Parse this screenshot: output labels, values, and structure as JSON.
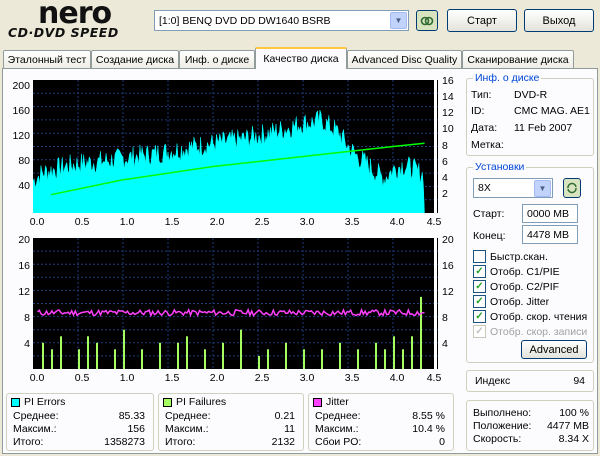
{
  "app": {
    "logo": "nero",
    "logo_sub": "CD·DVD SPEED"
  },
  "toolbar": {
    "drive": "[1:0]  BENQ DVD DD DW1640 BSRB",
    "start_label": "Старт",
    "exit_label": "Выход",
    "refresh_icon": "refresh-icon"
  },
  "tabs": [
    {
      "label": "Эталонный тест",
      "active": false
    },
    {
      "label": "Создание диска",
      "active": false
    },
    {
      "label": "Инф. о диске",
      "active": false
    },
    {
      "label": "Качество диска",
      "active": true
    },
    {
      "label": "Advanced Disc Quality",
      "active": false
    },
    {
      "label": "Сканирование диска",
      "active": false
    }
  ],
  "disc_info": {
    "title": "Инф. о диске",
    "type_label": "Тип:",
    "type_value": "DVD-R",
    "id_label": "ID:",
    "id_value": "CMC MAG. AE1",
    "date_label": "Дата:",
    "date_value": "11 Feb 2007",
    "label_label": "Метка:",
    "label_value": ""
  },
  "settings": {
    "title": "Установки",
    "speed": "8X",
    "start_label": "Старт:",
    "start_value": "0000 MB",
    "end_label": "Конец:",
    "end_value": "4478 MB",
    "checkboxes": [
      {
        "label": "Быстр.скан.",
        "checked": false,
        "enabled": true
      },
      {
        "label": "Отобр. C1/PIE",
        "checked": true,
        "enabled": true
      },
      {
        "label": "Отобр. C2/PIF",
        "checked": true,
        "enabled": true
      },
      {
        "label": "Отобр. Jitter",
        "checked": true,
        "enabled": true
      },
      {
        "label": "Отобр. скор. чтения",
        "checked": true,
        "enabled": true
      },
      {
        "label": "Отобр. скор. записи",
        "checked": true,
        "enabled": false
      }
    ],
    "advanced_label": "Advanced"
  },
  "index": {
    "label": "Индекс",
    "value": "94"
  },
  "progress": {
    "done_label": "Выполнено:",
    "done_value": "100 %",
    "position_label": "Положение:",
    "position_value": "4477 MB",
    "speed_label": "Скорость:",
    "speed_value": "8.34 X"
  },
  "stats": {
    "pi_errors": {
      "title": "PI Errors",
      "color": "#00FFFF",
      "avg_label": "Среднее:",
      "avg": "85.33",
      "max_label": "Максим.:",
      "max": "156",
      "total_label": "Итого:",
      "total": "1358273"
    },
    "pi_failures": {
      "title": "PI Failures",
      "color": "#A6FF60",
      "avg_label": "Среднее:",
      "avg": "0.21",
      "max_label": "Максим.:",
      "max": "11",
      "total_label": "Итого:",
      "total": "2132"
    },
    "jitter": {
      "title": "Jitter",
      "color": "#FF40FF",
      "avg_label": "Среднее:",
      "avg": "8.55 %",
      "max_label": "Максим.:",
      "max": "10.4 %",
      "po_label": "Сбои PO:",
      "po": "0"
    }
  },
  "chart_data": [
    {
      "type": "area",
      "name": "pi-errors-chart",
      "x_ticks": [
        "0.0",
        "0.5",
        "1.0",
        "1.5",
        "2.0",
        "2.5",
        "3.0",
        "3.5",
        "4.0",
        "4.5"
      ],
      "y_left_ticks": [
        "200",
        "160",
        "120",
        "80",
        "40"
      ],
      "y_right_ticks": [
        "16",
        "14",
        "12",
        "10",
        "8",
        "6",
        "4",
        "2"
      ],
      "xlim": [
        0,
        4.5
      ],
      "ylim_left": [
        0,
        200
      ],
      "ylim_right": [
        0,
        16
      ],
      "series": [
        {
          "color": "#00FFFF",
          "x": [
            0.0,
            0.1,
            0.3,
            0.5,
            0.8,
            1.0,
            1.2,
            1.5,
            1.8,
            2.0,
            2.3,
            2.5,
            2.8,
            3.0,
            3.1,
            3.2,
            3.3,
            3.4,
            3.5,
            3.6,
            3.7,
            3.8,
            3.9,
            4.0,
            4.1,
            4.2,
            4.3,
            4.35
          ],
          "values": [
            48,
            60,
            68,
            74,
            78,
            82,
            86,
            92,
            100,
            104,
            110,
            116,
            126,
            135,
            136,
            140,
            130,
            120,
            100,
            85,
            75,
            62,
            52,
            65,
            72,
            68,
            60,
            55
          ]
        },
        {
          "color": "#00FF00",
          "x": [
            0.2,
            1.0,
            2.0,
            3.0,
            3.5,
            4.0,
            4.35
          ],
          "values": [
            2.2,
            4.0,
            5.6,
            6.8,
            7.4,
            8.0,
            8.4
          ]
        }
      ]
    },
    {
      "type": "bar",
      "name": "pi-failures-chart",
      "x_ticks": [
        "0.0",
        "0.5",
        "1.0",
        "1.5",
        "2.0",
        "2.5",
        "3.0",
        "3.5",
        "4.0",
        "4.5"
      ],
      "y_left_ticks": [
        "20",
        "16",
        "12",
        "8",
        "4"
      ],
      "y_right_ticks": [
        "20",
        "16",
        "12",
        "8",
        "4"
      ],
      "xlim": [
        0,
        4.5
      ],
      "ylim": [
        0,
        20
      ],
      "series": [
        {
          "color": "#A6FF60",
          "x": [
            0.1,
            0.2,
            0.3,
            0.5,
            0.6,
            0.7,
            0.9,
            1.0,
            1.2,
            1.4,
            1.6,
            1.7,
            1.9,
            2.1,
            2.3,
            2.5,
            2.6,
            2.8,
            3.0,
            3.2,
            3.4,
            3.6,
            3.8,
            3.9,
            4.0,
            4.1,
            4.2,
            4.3
          ],
          "values": [
            4,
            3,
            5,
            3,
            5,
            4,
            3,
            6,
            3,
            4,
            4,
            5,
            3,
            4,
            6,
            2,
            3,
            4,
            3,
            3,
            4,
            3,
            4,
            3,
            5,
            3,
            5,
            11
          ]
        },
        {
          "color": "#FF40FF",
          "x": [
            0.05,
            4.35
          ],
          "values": [
            8.6,
            8.6
          ]
        }
      ]
    }
  ]
}
